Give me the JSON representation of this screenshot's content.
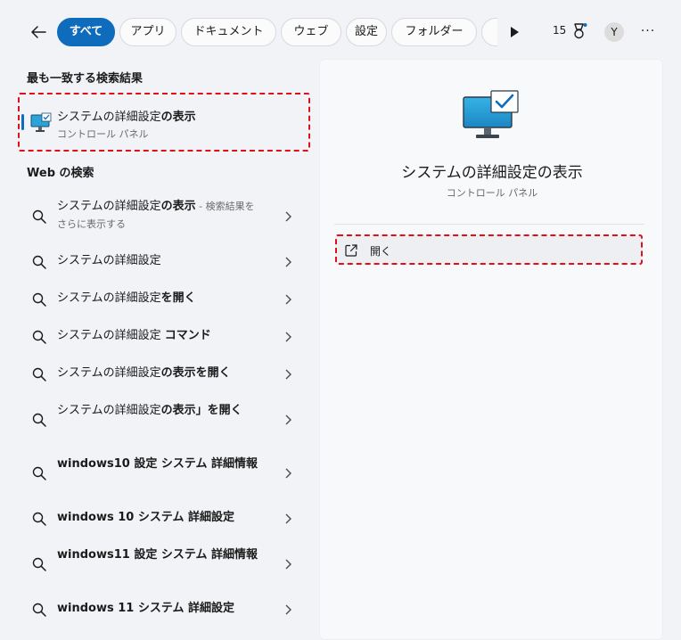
{
  "toolbar": {
    "filters": [
      {
        "label": "すべて",
        "active": true
      },
      {
        "label": "アプリ",
        "active": false
      },
      {
        "label": "ドキュメント",
        "active": false
      },
      {
        "label": "ウェブ",
        "active": false
      },
      {
        "label": "設定",
        "active": false
      },
      {
        "label": "フォルダー",
        "active": false
      }
    ],
    "rewards_count": "15",
    "avatar_initial": "Y",
    "more_label": "···"
  },
  "best_match": {
    "heading": "最も一致する検索結果",
    "title_plain": "システムの詳細設定",
    "title_bold": "の表示",
    "subtitle": "コントロール パネル"
  },
  "web": {
    "heading": "Web の検索",
    "items": [
      {
        "plain": "システムの詳細設定",
        "bold": "の表示",
        "sub": " - 検索結果をさらに表示する"
      },
      {
        "plain": "システムの詳細設定",
        "bold": ""
      },
      {
        "plain": "システムの詳細設定",
        "bold": "を開く"
      },
      {
        "plain": "システムの詳細設定 ",
        "bold": "コマンド"
      },
      {
        "plain": "システムの詳細設定",
        "bold": "の表示を開く"
      },
      {
        "plain": "システムの詳細設定",
        "bold": "の表示」を開く"
      },
      {
        "plain": "",
        "bold": "windows10 設定 システム 詳細情報"
      },
      {
        "plain": "",
        "bold": "windows 10 システム 詳細設定"
      },
      {
        "plain": "",
        "bold": "windows11 設定 システム 詳細情報"
      },
      {
        "plain": "",
        "bold": "windows 11 システム 詳細設定"
      }
    ]
  },
  "detail": {
    "title": "システムの詳細設定の表示",
    "subtitle": "コントロール パネル",
    "open_label": "開く"
  },
  "colors": {
    "accent": "#0f6cbd",
    "highlight_border": "#e0101a"
  }
}
